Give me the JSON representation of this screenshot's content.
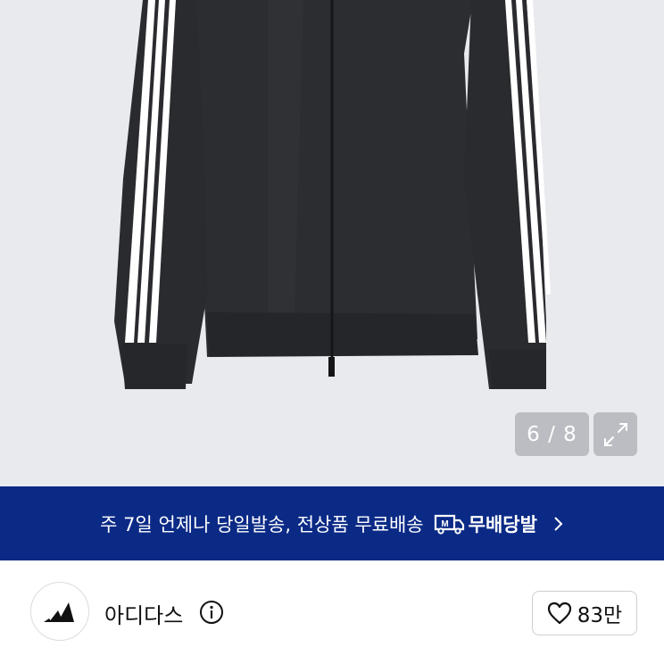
{
  "product_image": {
    "alt": "black track jacket with three white stripes",
    "counter": "6 / 8",
    "expand_icon": "expand-icon"
  },
  "promo_banner": {
    "text": "주 7일 언제나 당일발송, 전상품 무료배송",
    "badge_label": "무배당발",
    "badge_icon": "truck-m-icon",
    "chevron_icon": "chevron-right-icon"
  },
  "seller": {
    "name": "아디다스",
    "info_icon": "info-icon",
    "like_count": "83만",
    "like_icon": "heart-icon"
  },
  "colors": {
    "banner_bg": "#0b2a86",
    "hero_bg": "#e9eaee",
    "jacket": "#2a2b2e",
    "stripe": "#ffffff"
  }
}
